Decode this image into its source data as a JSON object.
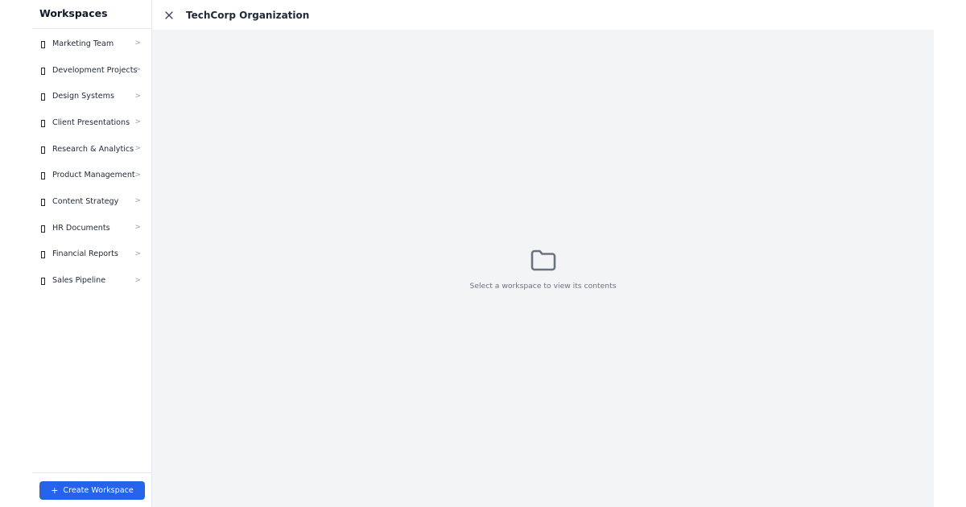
{
  "sidebar": {
    "title": "Workspaces",
    "items": [
      {
        "label": "Marketing Team"
      },
      {
        "label": "Development Projects"
      },
      {
        "label": "Design Systems"
      },
      {
        "label": "Client Presentations"
      },
      {
        "label": "Research & Analytics"
      },
      {
        "label": "Product Management"
      },
      {
        "label": "Content Strategy"
      },
      {
        "label": "HR Documents"
      },
      {
        "label": "Financial Reports"
      },
      {
        "label": "Sales Pipeline"
      }
    ],
    "create_button": {
      "icon": "+",
      "label": "Create Workspace"
    }
  },
  "header": {
    "close_icon": "close-icon",
    "title": "TechCorp Organization"
  },
  "main": {
    "empty_state": {
      "icon": "folder-icon",
      "text": "Select a workspace to view its contents"
    }
  },
  "colors": {
    "accent": "#2563eb",
    "content_background": "#f3f4f6",
    "border": "#e5e7eb",
    "muted_text": "#6b7280"
  }
}
